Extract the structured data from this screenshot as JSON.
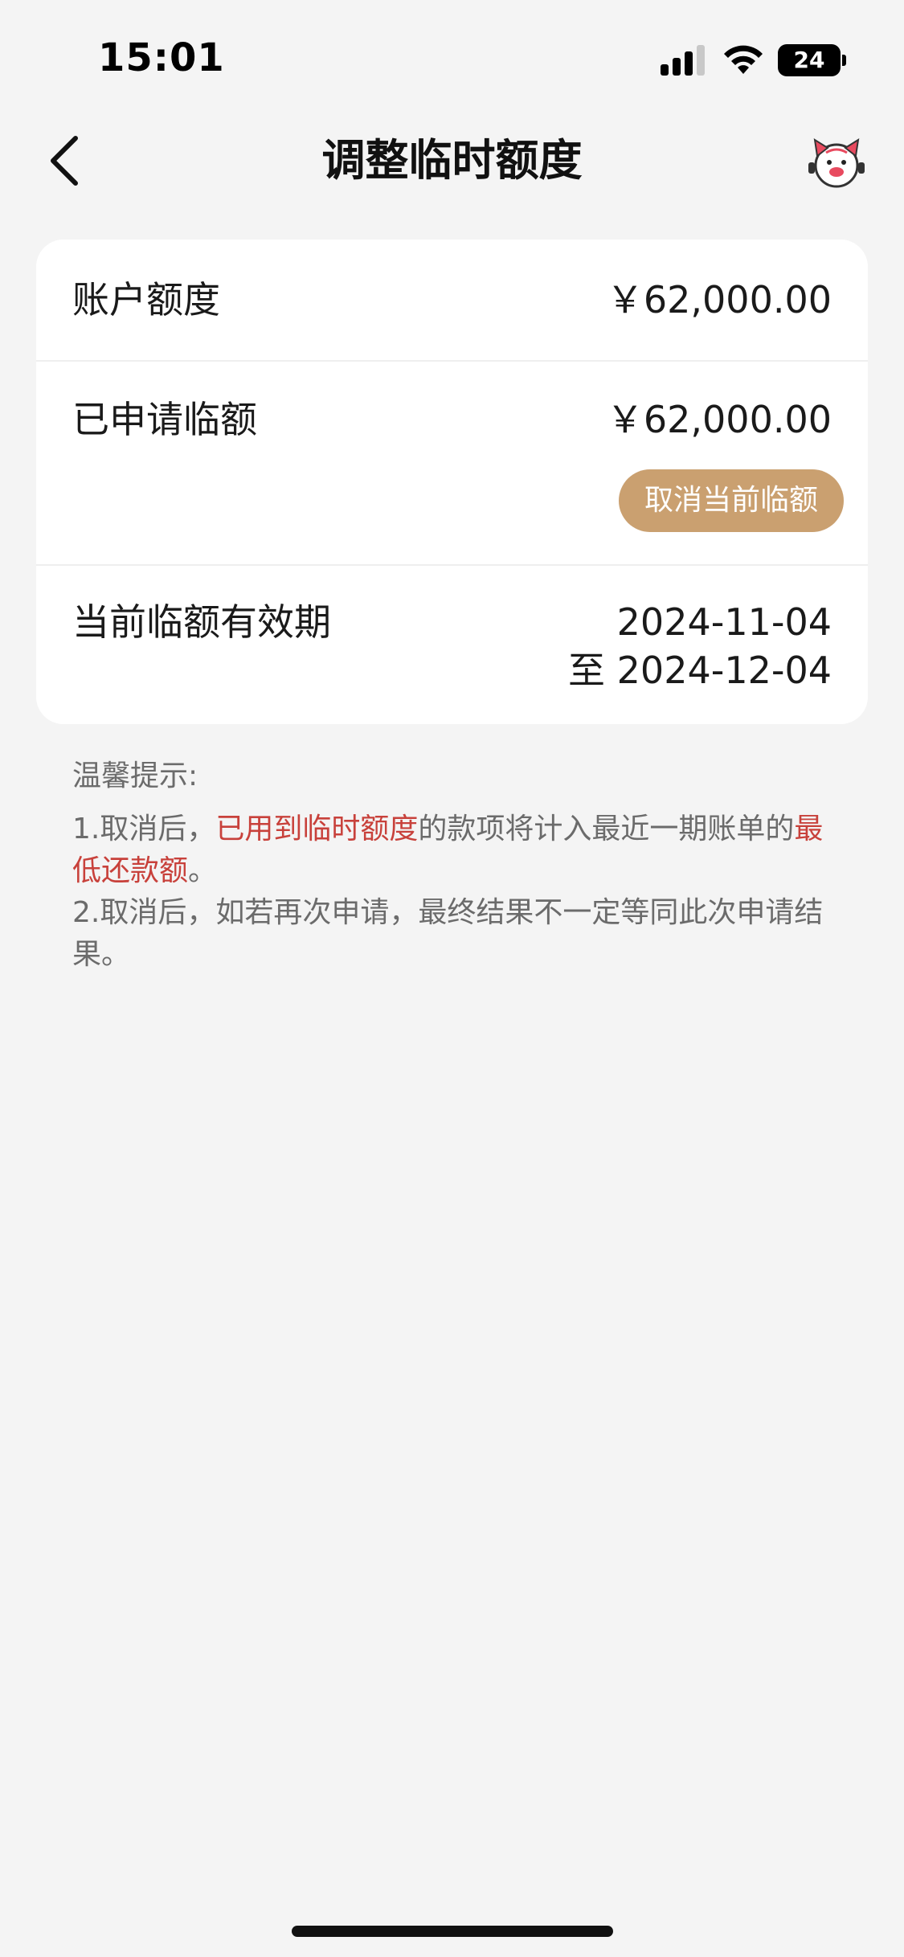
{
  "status_bar": {
    "time": "15:01",
    "battery": "24"
  },
  "nav": {
    "title": "调整临时额度",
    "back_icon": "chevron-left-icon",
    "assistant_icon": "mascot-icon"
  },
  "card": {
    "account_limit": {
      "label": "账户额度",
      "value": "￥62,000.00"
    },
    "applied_temp": {
      "label": "已申请临额",
      "value": "￥62,000.00",
      "cancel_label": "取消当前临额"
    },
    "validity": {
      "label": "当前临额有效期",
      "start": "2024-11-04",
      "end": "至 2024-12-04"
    }
  },
  "tips": {
    "title": "温馨提示:",
    "line1_prefix": "1.取消后，",
    "line1_highlight": "已用到临时额度",
    "line1_middle": "的款项将计入最近一期账单的",
    "line1_highlight2": "最低还款额",
    "line1_suffix": "。",
    "line2": "2.取消后，如若再次申请，最终结果不一定等同此次申请结果。"
  },
  "colors": {
    "accent": "#caa070",
    "highlight": "#c8413b",
    "background": "#f4f4f4"
  }
}
